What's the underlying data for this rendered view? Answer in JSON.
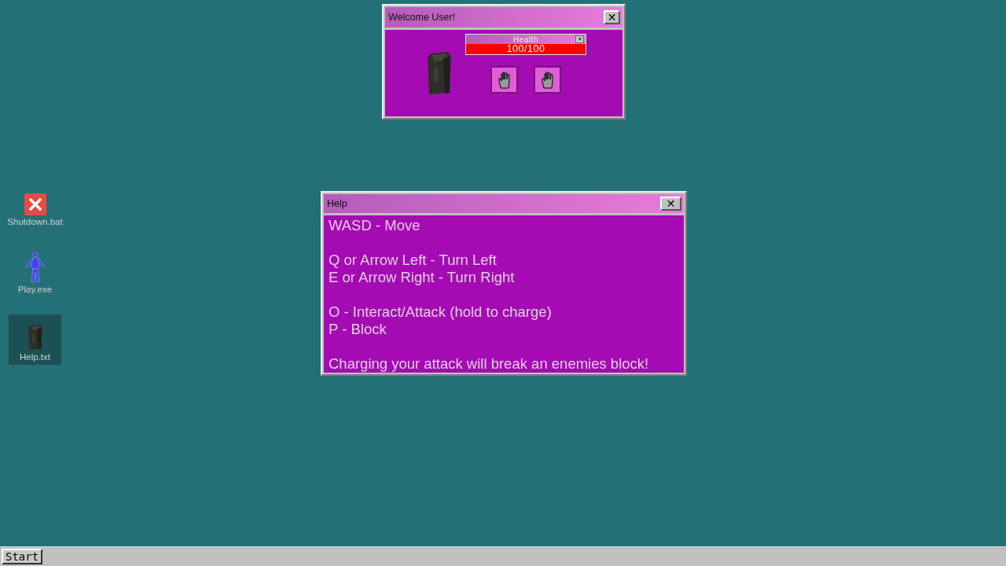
{
  "desktop_icons": [
    {
      "label": "Shutdown.bat",
      "kind": "shutdown",
      "selected": false
    },
    {
      "label": "Play.exe",
      "kind": "figure",
      "selected": false
    },
    {
      "label": "Help.txt",
      "kind": "statue",
      "selected": true
    }
  ],
  "welcome_window": {
    "title": "Welcome User!",
    "close": "✕",
    "health": {
      "title": "Health",
      "close": "✕",
      "reading": "100/100",
      "level": 1
    },
    "hands": [
      {
        "kind": "hand"
      },
      {
        "kind": "hand"
      }
    ]
  },
  "help_window": {
    "title": "Help",
    "close": "✕",
    "paragraphs": [
      [
        "WASD - Move"
      ],
      [
        "Q or Arrow Left - Turn Left",
        "E or Arrow Right - Turn Right"
      ],
      [
        "O - Interact/Attack (hold to charge)",
        "P - Block"
      ],
      [
        "Charging your attack will break an enemies block!"
      ]
    ]
  },
  "taskbar": {
    "start": "Start"
  }
}
